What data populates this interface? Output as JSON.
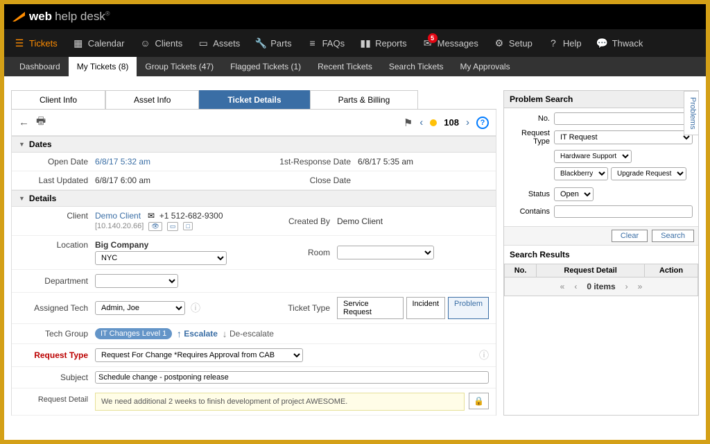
{
  "brand": {
    "bold": "web",
    "light": "help desk"
  },
  "nav": {
    "tickets": "Tickets",
    "calendar": "Calendar",
    "clients": "Clients",
    "assets": "Assets",
    "parts": "Parts",
    "faqs": "FAQs",
    "reports": "Reports",
    "messages": "Messages",
    "messages_badge": "5",
    "setup": "Setup",
    "help": "Help",
    "thwack": "Thwack"
  },
  "subnav": {
    "dashboard": "Dashboard",
    "my_tickets": "My Tickets (8)",
    "group_tickets": "Group Tickets (47)",
    "flagged": "Flagged Tickets (1)",
    "recent": "Recent Tickets",
    "search": "Search Tickets",
    "approvals": "My Approvals"
  },
  "tabs": {
    "client": "Client Info",
    "asset": "Asset Info",
    "details": "Ticket Details",
    "parts": "Parts & Billing"
  },
  "ticket_no": "108",
  "sections": {
    "dates": "Dates",
    "details": "Details"
  },
  "dates": {
    "open_label": "Open Date",
    "open_value": "6/8/17 5:32 am",
    "first_label": "1st-Response Date",
    "first_value": "6/8/17 5:35 am",
    "updated_label": "Last Updated",
    "updated_value": "6/8/17 6:00 am",
    "close_label": "Close Date"
  },
  "detail": {
    "client_label": "Client",
    "client_value": "Demo Client",
    "client_phone": "+1 512-682-9300",
    "client_ip": "[10.140.20.66]",
    "created_label": "Created By",
    "created_value": "Demo Client",
    "location_label": "Location",
    "location_value": "Big Company",
    "location_select": "NYC",
    "room_label": "Room",
    "dept_label": "Department",
    "tech_label": "Assigned Tech",
    "tech_value": "Admin, Joe",
    "ttype_label": "Ticket Type",
    "ttype_sr": "Service Request",
    "ttype_inc": "Incident",
    "ttype_prob": "Problem",
    "group_label": "Tech Group",
    "group_pill": "IT Changes  Level 1",
    "escalate": "Escalate",
    "deescalate": "De-escalate",
    "rtype_label": "Request Type",
    "rtype_value": "Request For Change *Requires Approval from CAB",
    "subject_label": "Subject",
    "subject_value": "Schedule change - postponing release",
    "rdetail_label": "Request Detail",
    "rdetail_value": "We need additional 2 weeks to finish development of project AWESOME."
  },
  "ps": {
    "title": "Problem Search",
    "side_tab": "Problems",
    "no_label": "No.",
    "rtype_label": "Request Type",
    "rtype_value": "IT Request",
    "chain1": "Hardware Support",
    "chain2": "Blackberry",
    "chain3": "Upgrade Request",
    "status_label": "Status",
    "status_value": "Open",
    "contains_label": "Contains",
    "clear": "Clear",
    "search": "Search"
  },
  "sr": {
    "title": "Search Results",
    "col_no": "No.",
    "col_detail": "Request Detail",
    "col_action": "Action",
    "items": "0 items"
  }
}
